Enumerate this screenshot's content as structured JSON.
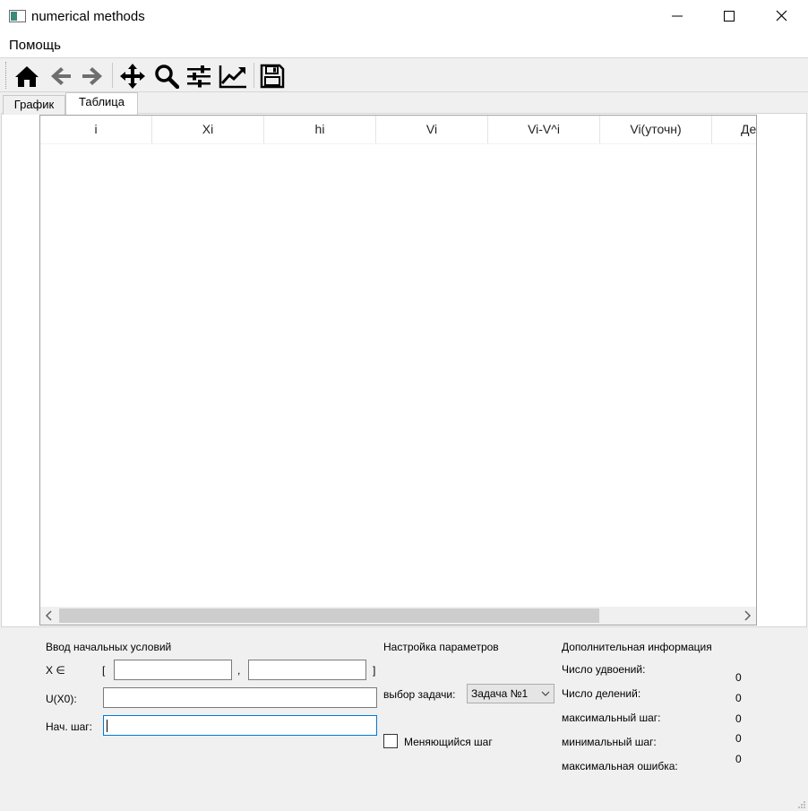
{
  "window": {
    "title": "numerical methods"
  },
  "menu": {
    "items": [
      "Помощь"
    ]
  },
  "toolbar": {
    "tools": [
      "home-icon",
      "back-arrow-icon",
      "forward-arrow-icon",
      "pan-icon",
      "zoom-icon",
      "configure-subplots-icon",
      "edit-axis-icon",
      "save-icon"
    ]
  },
  "tabs": [
    {
      "label": "График",
      "active": false
    },
    {
      "label": "Таблица",
      "active": true
    }
  ],
  "table": {
    "columns": [
      "i",
      "Xi",
      "hi",
      "Vi",
      "Vi-V^i",
      "Vi(уточн)",
      "Де"
    ],
    "rows": []
  },
  "initial_conditions": {
    "title": "Ввод начальных условий",
    "x_label": "X ∈",
    "bracket_open": "[",
    "comma": ",",
    "bracket_close": "]",
    "x_from": "",
    "x_to": "",
    "u_label": "U(X0):",
    "u_value": "",
    "step_label": "Нач. шаг:",
    "step_value": ""
  },
  "parameters": {
    "title": "Настройка параметров",
    "task_label": "выбор задачи:",
    "task_value": "Задача №1",
    "variable_step_label": "Меняющийся шаг",
    "variable_step_checked": false
  },
  "info": {
    "title": "Дополнительная информация",
    "doublings_label": "Число удвоений:",
    "doublings_value": "0",
    "divisions_label": "Число делений:",
    "divisions_value": "0",
    "max_step_label": "максимальный шаг:",
    "max_step_value": "0",
    "min_step_label": "минимальный шаг:",
    "min_step_value": "0",
    "max_error_label": "максимальная ошибка:",
    "max_error_value": "0"
  }
}
